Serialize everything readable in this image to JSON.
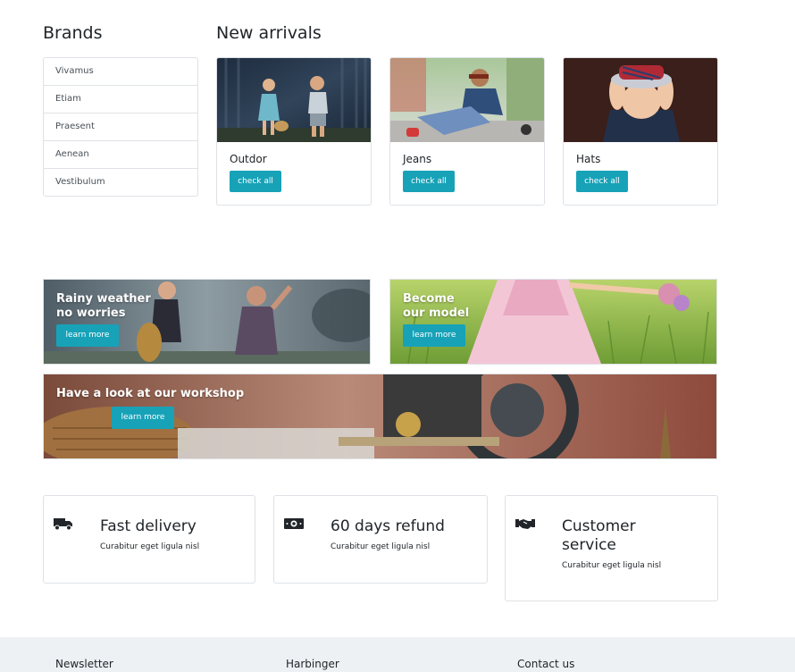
{
  "brands": {
    "title": "Brands",
    "items": [
      {
        "label": "Vivamus"
      },
      {
        "label": "Etiam"
      },
      {
        "label": "Praesent"
      },
      {
        "label": "Aenean"
      },
      {
        "label": "Vestibulum"
      }
    ]
  },
  "arrivals": {
    "title": "New arrivals",
    "cards": [
      {
        "title": "Outdor",
        "button": "check all"
      },
      {
        "title": "Jeans",
        "button": "check all"
      },
      {
        "title": "Hats",
        "button": "check all"
      }
    ]
  },
  "banners": [
    {
      "line1": "Rainy weather",
      "line2": "no worries",
      "button": "learn more"
    },
    {
      "line1": "Become",
      "line2": "our model",
      "button": "learn more"
    },
    {
      "line1": "Have a look at our workshop",
      "button": "learn more"
    }
  ],
  "features": [
    {
      "icon": "truck-icon",
      "title": "Fast delivery",
      "subtitle": "Curabitur eget ligula nisl"
    },
    {
      "icon": "money-bill-icon",
      "title": "60 days refund",
      "subtitle": "Curabitur eget ligula nisl"
    },
    {
      "icon": "handshake-icon",
      "title_line1": "Customer",
      "title_line2": "service",
      "subtitle": "Curabitur eget ligula nisl"
    }
  ],
  "footer": {
    "columns": [
      "Newsletter",
      "Harbinger",
      "Contact us"
    ]
  },
  "colors": {
    "accent": "#17a2b8",
    "border": "#dee2e6",
    "footer_bg": "#edf1f4"
  }
}
